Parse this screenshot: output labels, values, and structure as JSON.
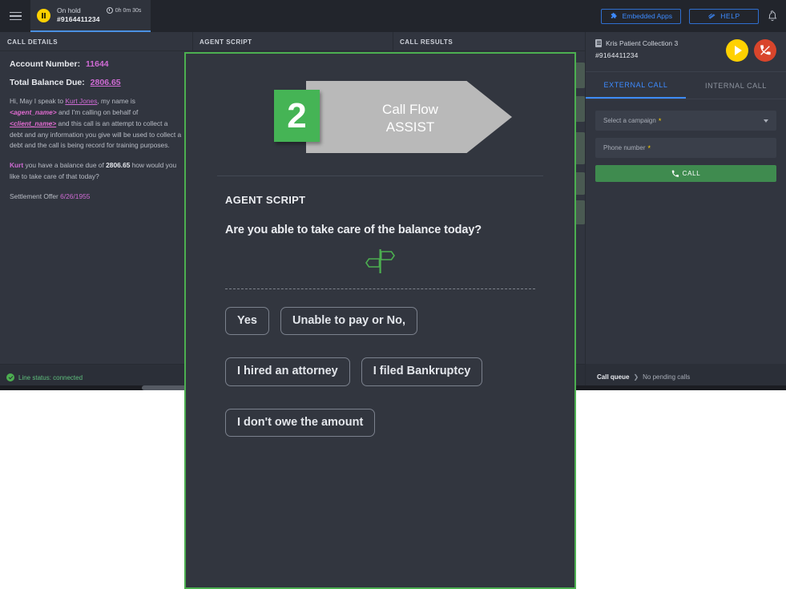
{
  "topbar": {
    "menu_icon": "hamburger-icon",
    "call_tab": {
      "status": "On hold",
      "number": "#9164411234",
      "timer": "0h 0m 30s"
    },
    "embedded_apps_label": "Embedded Apps",
    "help_label": "HELP",
    "bell_icon": "notification-bell-icon"
  },
  "columns": {
    "call_details": "CALL DETAILS",
    "agent_script": "AGENT SCRIPT",
    "call_results": "CALL RESULTS"
  },
  "call_details": {
    "account_number_label": "Account Number:",
    "account_number_value": "11644",
    "total_balance_label": "Total Balance Due:",
    "total_balance_value": "2806.65",
    "greeting": {
      "p1a": "Hi, May I speak to ",
      "customer": "Kurt Jones",
      "p1b": ", my name is ",
      "agent_placeholder": "<agent_name>",
      "p1c": " and I'm calling on behalf of ",
      "client_placeholder": "<client_name>",
      "p1d": " and this call is an attempt to collect a debt and any information you give will be used to collect a debt and the call is being record for training purposes."
    },
    "balance_line": {
      "name": "Kurt",
      "p1": " you have a balance due of ",
      "amount": "2806.65",
      "p2": " how would you like to take care of that today?"
    },
    "settlement": {
      "label": "Settlement Offer ",
      "date": "6/26/1955"
    }
  },
  "right_panel": {
    "record_title": "Kris Patient Collection 3",
    "record_number": "#9164411234",
    "play_icon": "play-call-icon",
    "hangup_icon": "end-call-icon",
    "tabs": [
      {
        "label": "EXTERNAL CALL",
        "active": true
      },
      {
        "label": "INTERNAL CALL",
        "active": false
      }
    ],
    "campaign_placeholder": "Select a campaign",
    "phone_placeholder": "Phone number",
    "required_marker": "*",
    "call_button_label": "CALL",
    "phone_icon": "phone-icon"
  },
  "status": {
    "line_status": "Line status: connected",
    "queue_label": "Call queue",
    "queue_separator": "❯",
    "queue_value": "No pending calls"
  },
  "modal": {
    "step_number": "2",
    "banner_line1": "Call Flow",
    "banner_line2": "ASSIST",
    "section_title": "AGENT SCRIPT",
    "question": "Are you able to take care of the balance today?",
    "signpost_icon": "signpost-directions-icon",
    "answers": [
      "Yes",
      "Unable to pay or No,",
      "I hired an attorney",
      "I filed Bankruptcy",
      "I don't owe the amount"
    ]
  },
  "colors": {
    "accent_blue": "#3d8bff",
    "green": "#4caf50",
    "yellow": "#ffd100",
    "red": "#d9452b",
    "magenta": "#cf6bd4",
    "bg_dark": "#31353f"
  }
}
